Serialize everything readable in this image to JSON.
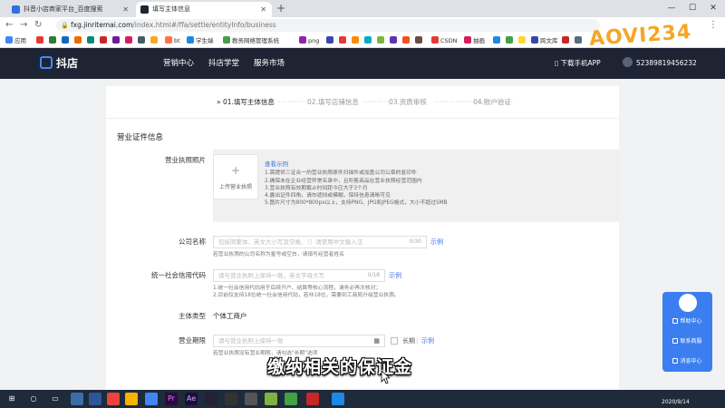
{
  "browser": {
    "tabs": [
      {
        "label": "抖音小店商家平台_百度搜索",
        "active": false
      },
      {
        "label": "填写主体信息",
        "active": true
      }
    ],
    "new_tab_glyph": "+",
    "url_host": "fxg.jinritemai.com",
    "url_path": "/index.html#/ffa/settle/entityInfo/business",
    "bookmarks": [
      "应用",
      "bt",
      "学生端",
      "教务网络管理系统",
      "png",
      "CSDN",
      "抽画",
      "跨文库"
    ],
    "window_controls": {
      "minimize": "—",
      "maximize": "☐",
      "close": "✕"
    }
  },
  "watermark": "AOVI234",
  "site": {
    "brand": "抖店",
    "nav": [
      "营销中心",
      "抖店学堂",
      "服务市场"
    ],
    "download_app": "下载手机APP",
    "user_id": "52389819456232"
  },
  "steps": [
    {
      "label": "01.填写主体信息",
      "active": true
    },
    {
      "label": "02.填写店铺信息",
      "active": false
    },
    {
      "label": "03.资质审核",
      "active": false
    },
    {
      "label": "04.账户验证",
      "active": false
    }
  ],
  "steps_marker": "»",
  "section_title": "营业证件信息",
  "license": {
    "label": "营业执照照片",
    "upload_plus": "+",
    "upload_text": "上传营业执照",
    "example_link": "查看示例",
    "tips": [
      "1.需提供三证合一的营业执照原件扫描件或加盖公司公章的复印件",
      "2.确保未在企业经营异常名录中，且所售商品在营业执照经营范围内",
      "3.营业执照有效期截止时间距今应大于3个月",
      "4.露出证件四角，请勿遮挡或模糊，保持信息清晰可见",
      "5.图片尺寸为800*800px以上，支持PNG、JPG和JPEG格式，大小不超过5MB"
    ]
  },
  "company_name": {
    "label": "公司名称",
    "placeholder": "包括简繁体、英文大小写及空格、（）请使用中文输入法",
    "counter": "0/30",
    "example": "示例",
    "hint": "若营业执照的公司名称为星号或空白，请填写经营者姓名"
  },
  "credit_code": {
    "label": "统一社会信用代码",
    "placeholder": "请与营业执照上保持一致，英文字母大写",
    "counter": "0/18",
    "example": "示例",
    "hints": [
      "1.统一社会信用代码用于后续开户、结算等核心流程，请务必再次核对；",
      "2.目前仅支持18位统一社会信用代码，若非18位，需要到工商局升级营业执照。"
    ]
  },
  "entity_type": {
    "label": "主体类型",
    "value": "个体工商户"
  },
  "business_term": {
    "label": "营业期限",
    "placeholder": "请与营业执照上保持一致",
    "calendar_glyph": "▦",
    "long_term": "长期",
    "separator": "|",
    "example": "示例",
    "hint": "若营业执照没有营业期限，请勾选\"长期\"选项"
  },
  "subtitle": "缴纳相关的保证金",
  "float_panel": {
    "items": [
      "帮助中心",
      "联系商服",
      "消息中心"
    ]
  },
  "taskbar": {
    "date": "2020/9/14"
  }
}
